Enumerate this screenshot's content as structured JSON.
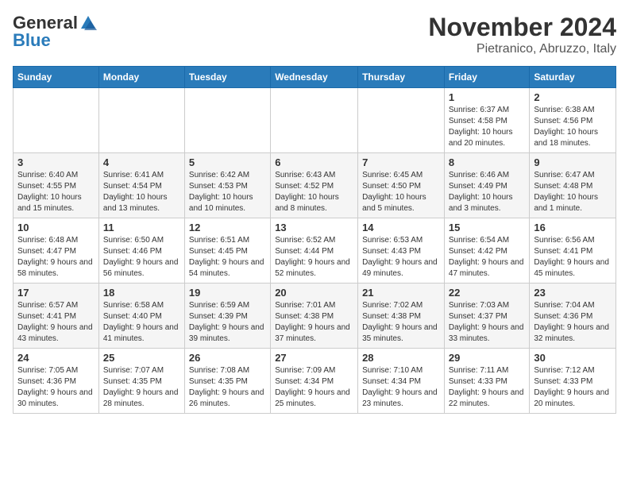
{
  "header": {
    "logo_general": "General",
    "logo_blue": "Blue",
    "month_title": "November 2024",
    "location": "Pietranico, Abruzzo, Italy"
  },
  "days_of_week": [
    "Sunday",
    "Monday",
    "Tuesday",
    "Wednesday",
    "Thursday",
    "Friday",
    "Saturday"
  ],
  "weeks": [
    [
      {
        "day": "",
        "info": ""
      },
      {
        "day": "",
        "info": ""
      },
      {
        "day": "",
        "info": ""
      },
      {
        "day": "",
        "info": ""
      },
      {
        "day": "",
        "info": ""
      },
      {
        "day": "1",
        "info": "Sunrise: 6:37 AM\nSunset: 4:58 PM\nDaylight: 10 hours and 20 minutes."
      },
      {
        "day": "2",
        "info": "Sunrise: 6:38 AM\nSunset: 4:56 PM\nDaylight: 10 hours and 18 minutes."
      }
    ],
    [
      {
        "day": "3",
        "info": "Sunrise: 6:40 AM\nSunset: 4:55 PM\nDaylight: 10 hours and 15 minutes."
      },
      {
        "day": "4",
        "info": "Sunrise: 6:41 AM\nSunset: 4:54 PM\nDaylight: 10 hours and 13 minutes."
      },
      {
        "day": "5",
        "info": "Sunrise: 6:42 AM\nSunset: 4:53 PM\nDaylight: 10 hours and 10 minutes."
      },
      {
        "day": "6",
        "info": "Sunrise: 6:43 AM\nSunset: 4:52 PM\nDaylight: 10 hours and 8 minutes."
      },
      {
        "day": "7",
        "info": "Sunrise: 6:45 AM\nSunset: 4:50 PM\nDaylight: 10 hours and 5 minutes."
      },
      {
        "day": "8",
        "info": "Sunrise: 6:46 AM\nSunset: 4:49 PM\nDaylight: 10 hours and 3 minutes."
      },
      {
        "day": "9",
        "info": "Sunrise: 6:47 AM\nSunset: 4:48 PM\nDaylight: 10 hours and 1 minute."
      }
    ],
    [
      {
        "day": "10",
        "info": "Sunrise: 6:48 AM\nSunset: 4:47 PM\nDaylight: 9 hours and 58 minutes."
      },
      {
        "day": "11",
        "info": "Sunrise: 6:50 AM\nSunset: 4:46 PM\nDaylight: 9 hours and 56 minutes."
      },
      {
        "day": "12",
        "info": "Sunrise: 6:51 AM\nSunset: 4:45 PM\nDaylight: 9 hours and 54 minutes."
      },
      {
        "day": "13",
        "info": "Sunrise: 6:52 AM\nSunset: 4:44 PM\nDaylight: 9 hours and 52 minutes."
      },
      {
        "day": "14",
        "info": "Sunrise: 6:53 AM\nSunset: 4:43 PM\nDaylight: 9 hours and 49 minutes."
      },
      {
        "day": "15",
        "info": "Sunrise: 6:54 AM\nSunset: 4:42 PM\nDaylight: 9 hours and 47 minutes."
      },
      {
        "day": "16",
        "info": "Sunrise: 6:56 AM\nSunset: 4:41 PM\nDaylight: 9 hours and 45 minutes."
      }
    ],
    [
      {
        "day": "17",
        "info": "Sunrise: 6:57 AM\nSunset: 4:41 PM\nDaylight: 9 hours and 43 minutes."
      },
      {
        "day": "18",
        "info": "Sunrise: 6:58 AM\nSunset: 4:40 PM\nDaylight: 9 hours and 41 minutes."
      },
      {
        "day": "19",
        "info": "Sunrise: 6:59 AM\nSunset: 4:39 PM\nDaylight: 9 hours and 39 minutes."
      },
      {
        "day": "20",
        "info": "Sunrise: 7:01 AM\nSunset: 4:38 PM\nDaylight: 9 hours and 37 minutes."
      },
      {
        "day": "21",
        "info": "Sunrise: 7:02 AM\nSunset: 4:38 PM\nDaylight: 9 hours and 35 minutes."
      },
      {
        "day": "22",
        "info": "Sunrise: 7:03 AM\nSunset: 4:37 PM\nDaylight: 9 hours and 33 minutes."
      },
      {
        "day": "23",
        "info": "Sunrise: 7:04 AM\nSunset: 4:36 PM\nDaylight: 9 hours and 32 minutes."
      }
    ],
    [
      {
        "day": "24",
        "info": "Sunrise: 7:05 AM\nSunset: 4:36 PM\nDaylight: 9 hours and 30 minutes."
      },
      {
        "day": "25",
        "info": "Sunrise: 7:07 AM\nSunset: 4:35 PM\nDaylight: 9 hours and 28 minutes."
      },
      {
        "day": "26",
        "info": "Sunrise: 7:08 AM\nSunset: 4:35 PM\nDaylight: 9 hours and 26 minutes."
      },
      {
        "day": "27",
        "info": "Sunrise: 7:09 AM\nSunset: 4:34 PM\nDaylight: 9 hours and 25 minutes."
      },
      {
        "day": "28",
        "info": "Sunrise: 7:10 AM\nSunset: 4:34 PM\nDaylight: 9 hours and 23 minutes."
      },
      {
        "day": "29",
        "info": "Sunrise: 7:11 AM\nSunset: 4:33 PM\nDaylight: 9 hours and 22 minutes."
      },
      {
        "day": "30",
        "info": "Sunrise: 7:12 AM\nSunset: 4:33 PM\nDaylight: 9 hours and 20 minutes."
      }
    ]
  ]
}
